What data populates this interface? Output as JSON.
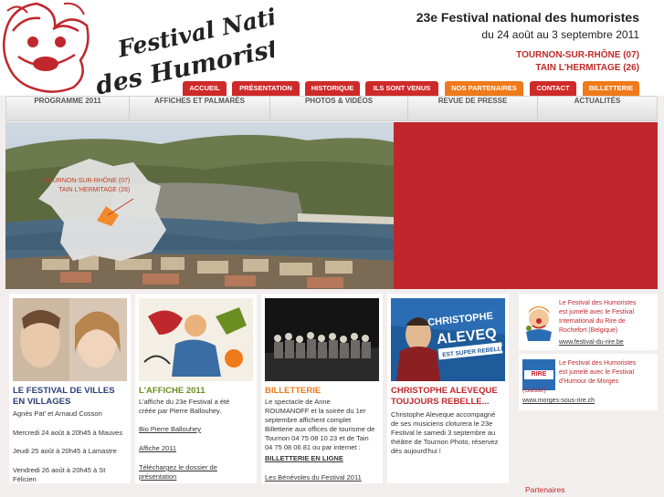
{
  "header": {
    "title": "23e Festival national des humoristes",
    "dates": "du 24 août au 3 septembre 2011",
    "location_1": "TOURNON-SUR-RHÔNE (07)",
    "location_2": "TAIN L'HERMITAGE (26)",
    "logo_text_line1": "Festival National",
    "logo_text_line2": "des Humoristes"
  },
  "topnav": [
    {
      "label": "ACCUEIL"
    },
    {
      "label": "PRÉSENTATION"
    },
    {
      "label": "HISTORIQUE"
    },
    {
      "label": "ILS SONT VENUS"
    },
    {
      "label": "NOS PARTENAIRES"
    },
    {
      "label": "CONTACT"
    },
    {
      "label": "BILLETTERIE"
    }
  ],
  "mainnav": [
    {
      "label": "PROGRAMME 2011"
    },
    {
      "label": "AFFICHES ET PALMARÈS"
    },
    {
      "label": "PHOTOS & VIDÉOS"
    },
    {
      "label": "REVUE DE PRESSE"
    },
    {
      "label": "ACTUALITÉS"
    }
  ],
  "hero": {
    "map_label_1": "TOURNON-SUR-RHÔNE (07)",
    "map_label_2": "TAIN L'HERMITAGE (26)"
  },
  "columns": [
    {
      "title": "LE FESTIVAL DE VILLES EN VILLAGES",
      "lines": [
        "Agnès Pat' et Arnaud Cosson",
        "Mercredi 24 août à 20h45 à Mauves",
        "Jeudi 25 août à 20h45 à Lamastre",
        "Vendredi 26 août à 20h45 à St",
        "Félicien"
      ]
    },
    {
      "title": "L'AFFICHE 2011",
      "text_1": "L'affiche du 23e Festival a été",
      "text_2": "créée par Pierre Ballouhey.",
      "link_1": "Bio Pierre Ballouhey",
      "link_2": "Affiche 2011",
      "link_3a": "Téléchargez le dossier de",
      "link_3b": "présentation"
    },
    {
      "title": "BILLETTERIE",
      "lines": [
        "Le spectacle de Anne",
        "ROUMANOFF et la soirée du 1er",
        "septembre affichent complet",
        "Billetterie aux offices de tourisme de",
        "Tournon 04 75 08 10 23 et de Tain",
        "04 75 08 06 81 ou par internet :"
      ],
      "link_1": "BILLETTERIE EN LIGNE",
      "link_2": "Les Bénévoles du Festival 2011"
    },
    {
      "title": "CHRISTOPHE ALEVEQUE TOUJOURS REBELLE...",
      "lines": [
        "Christophe Aleveque accompagné",
        "de ses musiciens cloturera le 23e",
        "Festival le samedi 3 septembre au",
        "théâtre de Tournon Photo, réservez",
        "dès aujourd'hui !"
      ],
      "poster_text_1": "CHRISTOPHE",
      "poster_text_2": "ALEVEQ",
      "poster_text_3": "EST SUPER REBELLE"
    }
  ],
  "sidebar": {
    "box_1": {
      "lines": [
        "Le Festival des Humoristes",
        "est jumelé avec le Festival",
        "International du Rire de",
        "Rochefort (Belgique)"
      ],
      "link": "www.festival-du-rire.be"
    },
    "box_2": {
      "badge": "RIRE",
      "lines": [
        "Le Festival des Humoristes",
        "est jumelé avec le Festival",
        "d'Humour de Morges",
        "(Suisse)"
      ],
      "link": "www.morges-sous-rire.ch"
    },
    "partners_label": "Partenaires"
  },
  "colors": {
    "brand_red": "#c0272d",
    "nav_red": "#cf2a2a",
    "nav_orange": "#ef7a1a",
    "title_blue": "#2a3f7a",
    "affiche_green": "#6b8e23"
  },
  "icons": [
    "jester-logo-icon",
    "map-pin-icon",
    "clown-icon"
  ]
}
